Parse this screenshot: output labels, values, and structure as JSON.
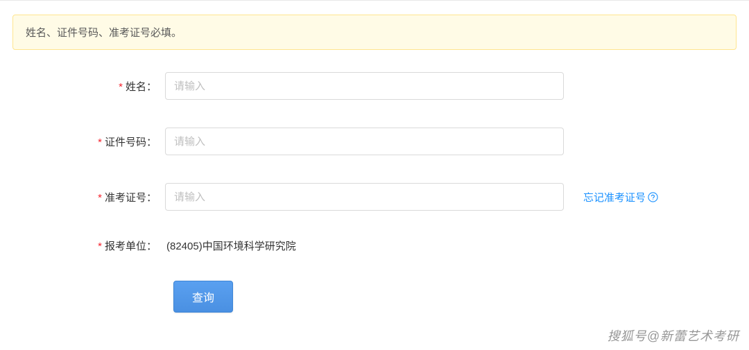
{
  "alert": {
    "message": "姓名、证件号码、准考证号必填。"
  },
  "form": {
    "name": {
      "label": "姓名：",
      "placeholder": "请输入"
    },
    "id_number": {
      "label": "证件号码：",
      "placeholder": "请输入"
    },
    "exam_number": {
      "label": "准考证号：",
      "placeholder": "请输入",
      "forgot_link": "忘记准考证号"
    },
    "institution": {
      "label": "报考单位：",
      "value": "(82405)中国环境科学研究院"
    },
    "submit_label": "查询"
  },
  "watermark": "搜狐号@新蕾艺术考研"
}
